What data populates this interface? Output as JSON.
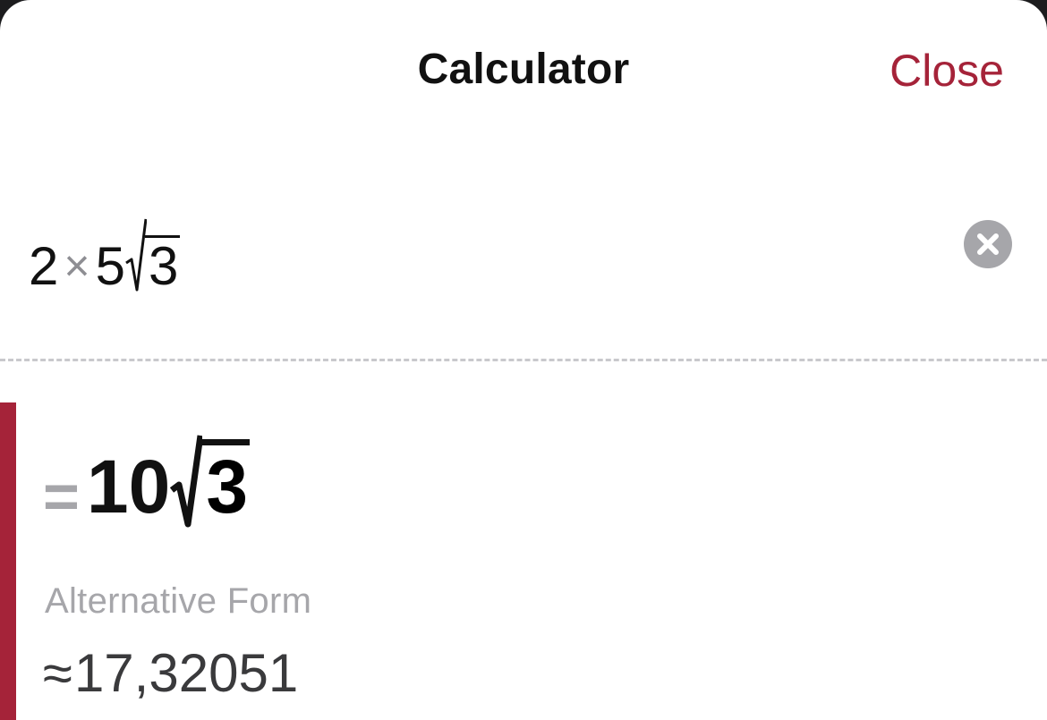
{
  "header": {
    "title": "Calculator",
    "close_label": "Close"
  },
  "input": {
    "tokens": {
      "a": "2",
      "times": "×",
      "b": "5",
      "radicand": "3"
    },
    "clear_icon": "clear-x-circle-icon"
  },
  "result": {
    "equals": "=",
    "coefficient": "10",
    "radicand": "3"
  },
  "alternative": {
    "label": "Alternative Form",
    "approx_symbol": "≈",
    "value": "17,32051"
  },
  "colors": {
    "accent": "#a52339",
    "muted": "#a6a6aa",
    "text": "#111111"
  }
}
